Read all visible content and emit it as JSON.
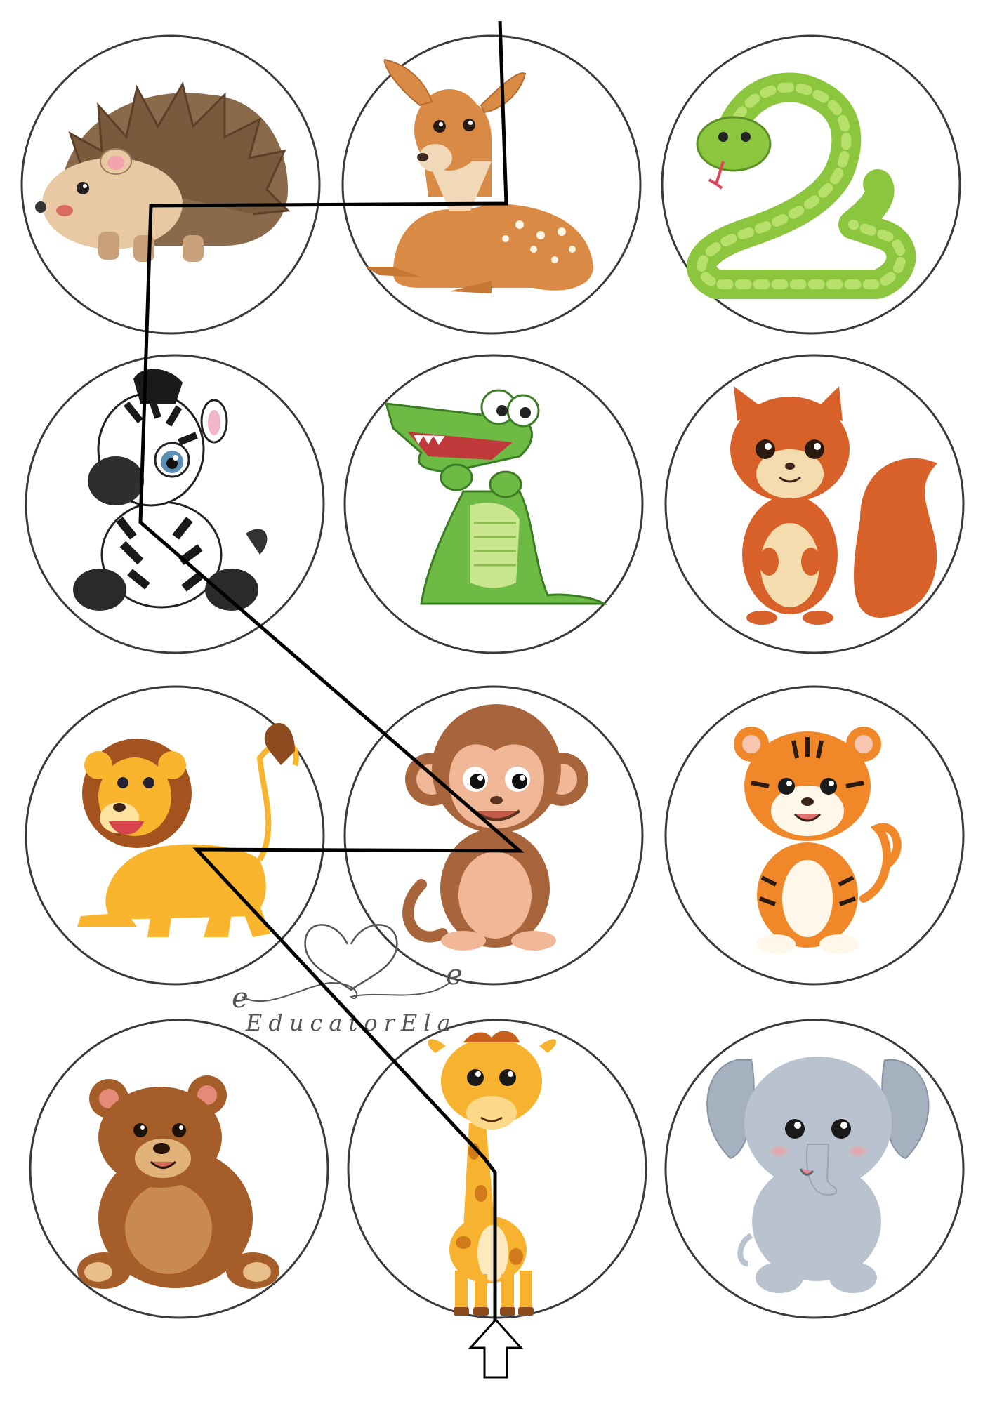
{
  "sheet": {
    "title": "",
    "grid": {
      "rows": 4,
      "cols": 3
    },
    "animals": [
      {
        "name": "hedgehog",
        "row": 1,
        "col": 1
      },
      {
        "name": "fawn",
        "row": 1,
        "col": 2
      },
      {
        "name": "snake",
        "row": 1,
        "col": 3
      },
      {
        "name": "zebra",
        "row": 2,
        "col": 1
      },
      {
        "name": "crocodile",
        "row": 2,
        "col": 2
      },
      {
        "name": "squirrel",
        "row": 2,
        "col": 3
      },
      {
        "name": "lion",
        "row": 3,
        "col": 1
      },
      {
        "name": "monkey",
        "row": 3,
        "col": 2
      },
      {
        "name": "tiger",
        "row": 3,
        "col": 3
      },
      {
        "name": "bear",
        "row": 4,
        "col": 1
      },
      {
        "name": "giraffe",
        "row": 4,
        "col": 2
      },
      {
        "name": "elephant",
        "row": 4,
        "col": 3
      }
    ],
    "path_order": [
      "giraffe",
      "lion",
      "monkey",
      "zebra",
      "hedgehog",
      "fawn"
    ],
    "start_marker": "up-arrow-icon"
  },
  "watermark": {
    "initial_left": "e",
    "initial_right": "e",
    "text": "EducatorEla"
  },
  "colors": {
    "circle_stroke": "#3a3a3a",
    "path_stroke": "#000000",
    "watermark": "#555555",
    "background": "#ffffff"
  }
}
